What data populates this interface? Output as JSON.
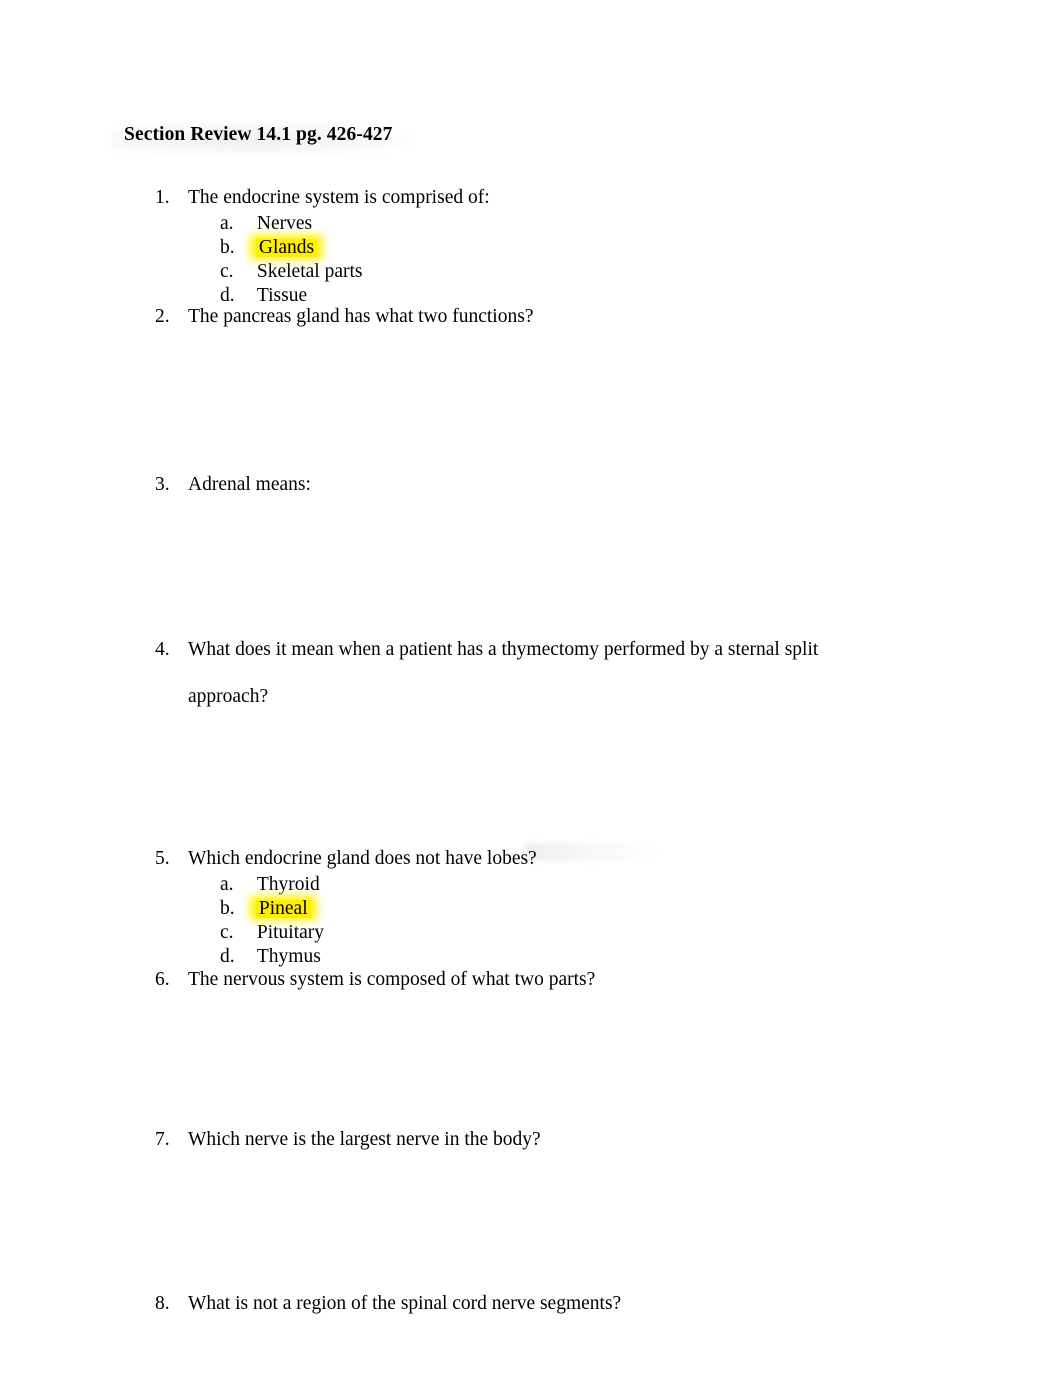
{
  "document": {
    "title": "Section Review 14.1 pg. 426-427",
    "highlight_color": "#FFF200",
    "text_color": "#000000",
    "page_background": "#FFFFFF"
  },
  "questions": [
    {
      "number": "1.",
      "text": "The endocrine system is comprised of:",
      "options": [
        {
          "letter": "a.",
          "label": "Nerves",
          "highlighted": false
        },
        {
          "letter": "b.",
          "label": "Glands",
          "highlighted": true
        },
        {
          "letter": "c.",
          "label": "Skeletal parts",
          "highlighted": false
        },
        {
          "letter": "d.",
          "label": "Tissue",
          "highlighted": false
        }
      ]
    },
    {
      "number": "2.",
      "text": "The pancreas gland has what two functions?",
      "options": []
    },
    {
      "number": "3.",
      "text": "Adrenal means:",
      "options": []
    },
    {
      "number": "4.",
      "text": "What does it mean when a patient has a thymectomy performed by a sternal split approach?",
      "options": []
    },
    {
      "number": "5.",
      "text": "Which endocrine gland does not have lobes?",
      "options": [
        {
          "letter": "a.",
          "label": "Thyroid",
          "highlighted": false
        },
        {
          "letter": "b.",
          "label": "Pineal",
          "highlighted": true
        },
        {
          "letter": "c.",
          "label": "Pituitary",
          "highlighted": false
        },
        {
          "letter": "d.",
          "label": "Thymus",
          "highlighted": false
        }
      ]
    },
    {
      "number": "6.",
      "text": "The nervous system is composed of what two parts?",
      "options": []
    },
    {
      "number": "7.",
      "text": "Which nerve is the largest nerve in the body?",
      "options": []
    },
    {
      "number": "8.",
      "text": "What is not a region of the spinal cord nerve segments?",
      "options": []
    }
  ]
}
